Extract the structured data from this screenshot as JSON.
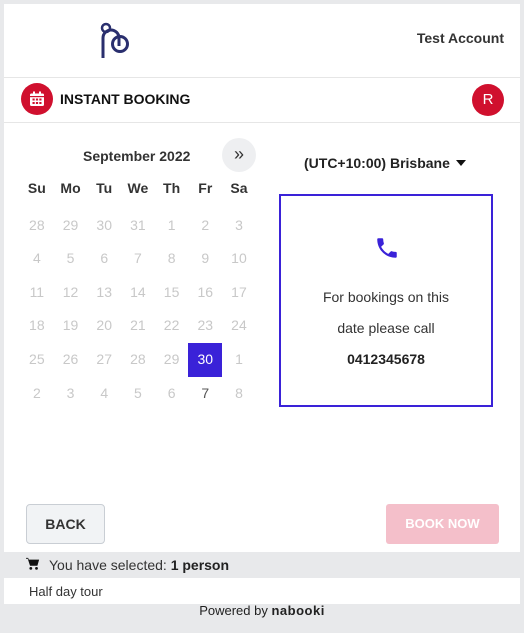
{
  "header": {
    "account": "Test Account"
  },
  "titlebar": {
    "title": "INSTANT BOOKING",
    "avatar_initial": "R"
  },
  "calendar": {
    "month_label": "September 2022",
    "next_label": "»",
    "weekdays": [
      "Su",
      "Mo",
      "Tu",
      "We",
      "Th",
      "Fr",
      "Sa"
    ],
    "weeks": [
      [
        "28",
        "29",
        "30",
        "31",
        "1",
        "2",
        "3"
      ],
      [
        "4",
        "5",
        "6",
        "7",
        "8",
        "9",
        "10"
      ],
      [
        "11",
        "12",
        "13",
        "14",
        "15",
        "16",
        "17"
      ],
      [
        "18",
        "19",
        "20",
        "21",
        "22",
        "23",
        "24"
      ],
      [
        "25",
        "26",
        "27",
        "28",
        "29",
        "30",
        "1"
      ],
      [
        "2",
        "3",
        "4",
        "5",
        "6",
        "7",
        "8"
      ]
    ],
    "selected_day": "30"
  },
  "timezone": {
    "label": "(UTC+10:00) Brisbane"
  },
  "callbox": {
    "line1": "For bookings on this",
    "line2": "date please call",
    "phone": "0412345678"
  },
  "actions": {
    "back": "BACK",
    "book": "BOOK NOW"
  },
  "selection": {
    "prefix": "You have selected:",
    "value": "1 person"
  },
  "tour_name": "Half day tour",
  "footer": {
    "powered": "Powered by",
    "brand": "nabooki"
  },
  "colors": {
    "accent": "#3a22d8",
    "brand_red": "#d0102e",
    "book_disabled": "#f4bfca"
  },
  "icons": [
    "logo-icon",
    "calendar-icon",
    "phone-icon",
    "cart-icon",
    "chevron-down-icon"
  ]
}
